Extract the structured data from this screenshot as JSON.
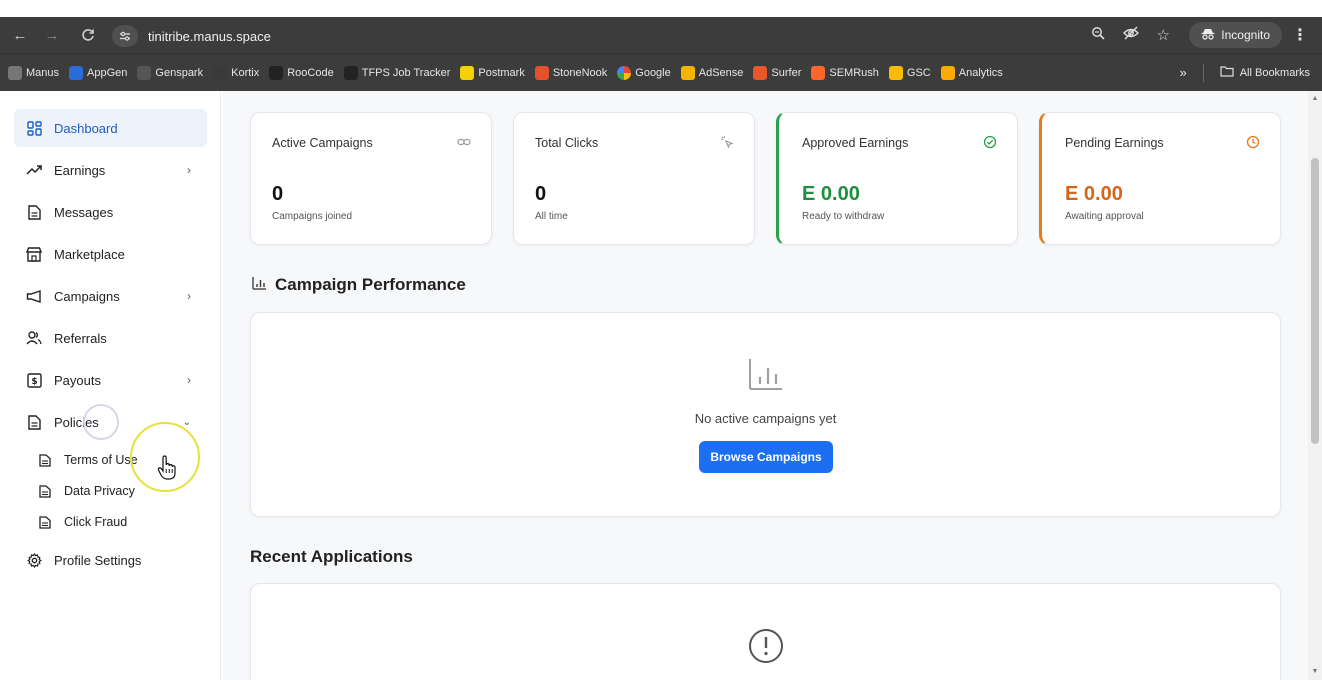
{
  "browser": {
    "url": "tinitribe.manus.space",
    "incognito_label": "Incognito",
    "bookmarks": [
      {
        "label": "Manus",
        "icon": "manus-icon",
        "color": "#777777"
      },
      {
        "label": "AppGen",
        "icon": "appgen-icon",
        "color": "#2b6cd8"
      },
      {
        "label": "Genspark",
        "icon": "genspark-icon",
        "color": "#555555"
      },
      {
        "label": "Kortix",
        "icon": "kortix-icon",
        "color": "#3a3a3a"
      },
      {
        "label": "RooCode",
        "icon": "roocode-icon",
        "color": "#222222"
      },
      {
        "label": "TFPS Job Tracker",
        "icon": "tfps-icon",
        "color": "#222222"
      },
      {
        "label": "Postmark",
        "icon": "postmark-icon",
        "color": "#f2d200"
      },
      {
        "label": "StoneNook",
        "icon": "stonenook-icon",
        "color": "#e4502a"
      },
      {
        "label": "Google",
        "icon": "google-icon",
        "color": "#ffffff"
      },
      {
        "label": "AdSense",
        "icon": "adsense-icon",
        "color": "#f4b400"
      },
      {
        "label": "Surfer",
        "icon": "surfer-icon",
        "color": "#e8582a"
      },
      {
        "label": "SEMRush",
        "icon": "semrush-icon",
        "color": "#ff642d"
      },
      {
        "label": "GSC",
        "icon": "gsc-icon",
        "color": "#fbbc05"
      },
      {
        "label": "Analytics",
        "icon": "analytics-icon",
        "color": "#f9ab00"
      }
    ],
    "overflow_label": "»",
    "all_bookmarks_label": "All Bookmarks"
  },
  "sidebar": {
    "items": [
      {
        "label": "Dashboard",
        "icon": "dashboard-icon"
      },
      {
        "label": "Earnings",
        "icon": "trending-up-icon"
      },
      {
        "label": "Messages",
        "icon": "document-icon"
      },
      {
        "label": "Marketplace",
        "icon": "store-icon"
      },
      {
        "label": "Campaigns",
        "icon": "megaphone-icon"
      },
      {
        "label": "Referrals",
        "icon": "users-icon"
      },
      {
        "label": "Payouts",
        "icon": "dollar-box-icon"
      },
      {
        "label": "Policies",
        "icon": "document-icon"
      },
      {
        "label": "Profile Settings",
        "icon": "gear-icon"
      }
    ],
    "policies_sub": [
      {
        "label": "Terms of Use",
        "icon": "document-icon"
      },
      {
        "label": "Data Privacy",
        "icon": "document-icon"
      },
      {
        "label": "Click Fraud",
        "icon": "document-icon"
      }
    ]
  },
  "stats": [
    {
      "title": "Active Campaigns",
      "value": "0",
      "sub": "Campaigns joined",
      "icon": "link-icon",
      "color": "#111111"
    },
    {
      "title": "Total Clicks",
      "value": "0",
      "sub": "All time",
      "icon": "click-icon",
      "color": "#111111"
    },
    {
      "title": "Approved Earnings",
      "value": "E 0.00",
      "sub": "Ready to withdraw",
      "icon": "check-circle-icon",
      "color": "#1d8f3e"
    },
    {
      "title": "Pending Earnings",
      "value": "E 0.00",
      "sub": "Awaiting approval",
      "icon": "clock-icon",
      "color": "#d4651a"
    }
  ],
  "performance": {
    "title": "Campaign Performance",
    "empty_text": "No active campaigns yet",
    "button_label": "Browse Campaigns"
  },
  "recent": {
    "title": "Recent Applications"
  },
  "colors": {
    "accent": "#1d6ff2",
    "active_nav_bg": "#eef3fb",
    "green": "#22a34a",
    "orange": "#ea7a1a"
  }
}
